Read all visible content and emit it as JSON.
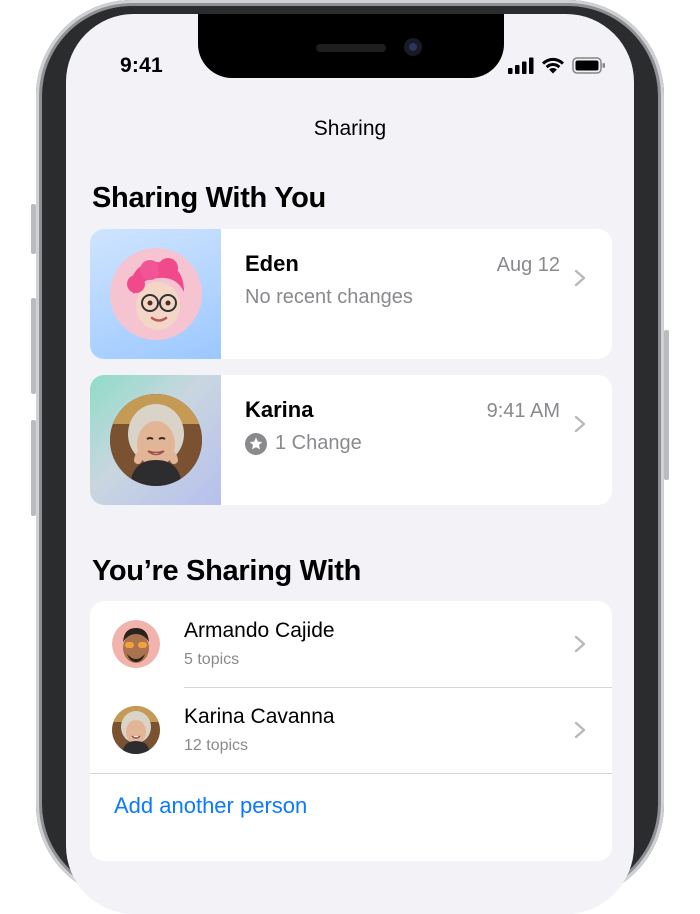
{
  "status_bar": {
    "time": "9:41"
  },
  "nav": {
    "title": "Sharing"
  },
  "sharing_with_you": {
    "heading": "Sharing With You",
    "items": [
      {
        "name": "Eden",
        "subtitle": "No recent changes",
        "date": "Aug 12"
      },
      {
        "name": "Karina",
        "subtitle": "1 Change",
        "date": "9:41 AM"
      }
    ]
  },
  "youre_sharing_with": {
    "heading": "You’re Sharing With",
    "people": [
      {
        "name": "Armando Cajide",
        "topics": "5 topics"
      },
      {
        "name": "Karina Cavanna",
        "topics": "12 topics"
      }
    ],
    "add_label": "Add another person"
  },
  "colors": {
    "accent": "#0a7aff",
    "background": "#f2f2f7",
    "secondary_text": "#8a8a8e"
  }
}
